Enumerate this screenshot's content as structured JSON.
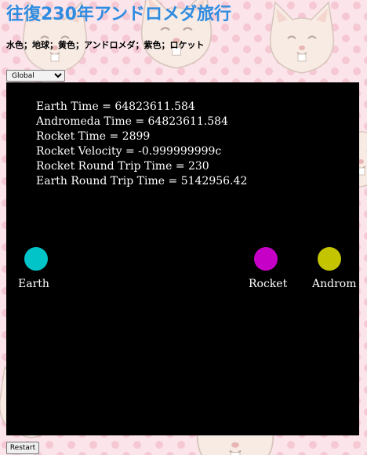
{
  "page": {
    "title": "往復230年アンドロメダ旅行",
    "legend": "水色；地球；黄色；アンドロメダ；紫色；ロケット"
  },
  "frame_select": {
    "selected": "Global",
    "options": [
      "Global"
    ]
  },
  "readouts": [
    "Earth Time = 64823611.584",
    "Andromeda Time = 64823611.584",
    "Rocket Time = 2899",
    "Rocket Velocity = -0.999999999c",
    "Rocket Round Trip Time = 230",
    "Earth Round Trip Time = 5142956.42"
  ],
  "bodies": {
    "earth": {
      "label": "Earth",
      "color": "#00c4c8"
    },
    "rocket": {
      "label": "Rocket",
      "color": "#c600c6"
    },
    "andromeda": {
      "label": "Androm",
      "color": "#c4c400"
    }
  },
  "controls": {
    "restart_label": "Restart"
  },
  "colors": {
    "title": "#2f8ce0",
    "page_background": "#fbe4ea",
    "canvas_background": "#000000"
  }
}
